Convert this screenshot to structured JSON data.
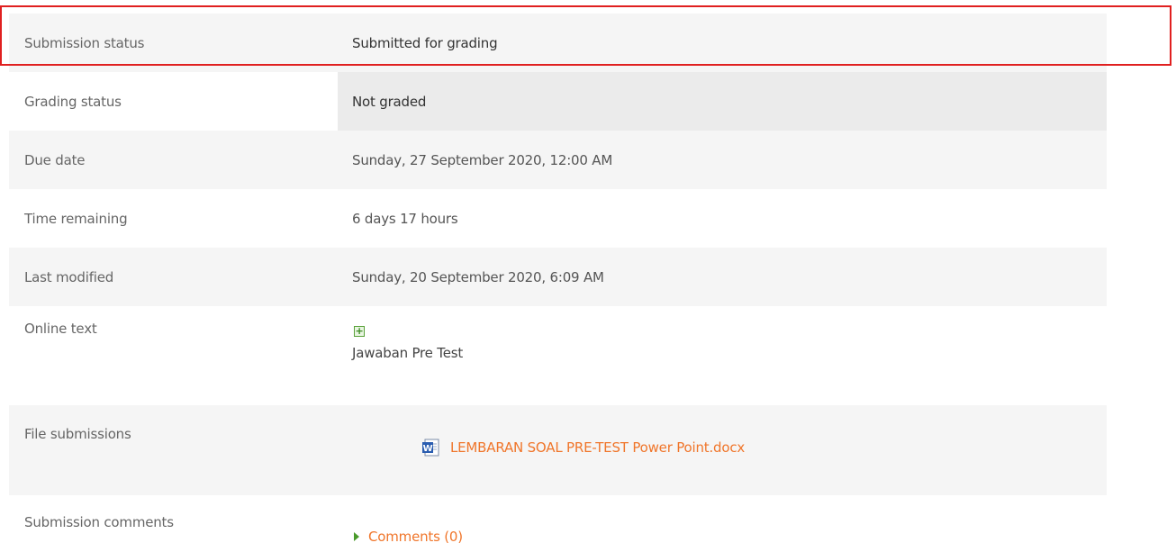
{
  "rows": {
    "submission_status": {
      "label": "Submission status",
      "value": "Submitted for grading"
    },
    "grading_status": {
      "label": "Grading status",
      "value": "Not graded"
    },
    "due_date": {
      "label": "Due date",
      "value": "Sunday, 27 September 2020, 12:00 AM"
    },
    "time_remaining": {
      "label": "Time remaining",
      "value": "6 days 17 hours"
    },
    "last_modified": {
      "label": "Last modified",
      "value": "Sunday, 20 September 2020, 6:09 AM"
    },
    "online_text": {
      "label": "Online text",
      "value": "Jawaban Pre Test",
      "expand_icon": "plus-box-icon"
    },
    "file_submissions": {
      "label": "File submissions",
      "file_name": "LEMBARAN SOAL PRE-TEST Power Point.docx",
      "file_icon": "word-doc-icon"
    },
    "submission_comments": {
      "label": "Submission comments",
      "link": "Comments (0)",
      "toggle_icon": "triangle-right-icon"
    }
  },
  "colors": {
    "row_shaded": "#f5f5f5",
    "value_highlight": "#ebebeb",
    "link": "#f0762b",
    "highlight_border": "#e02020"
  }
}
